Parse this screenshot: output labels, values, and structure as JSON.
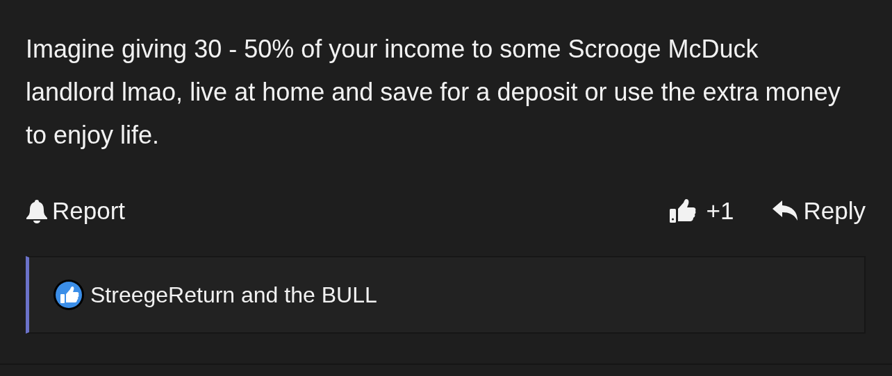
{
  "comment": {
    "text": "Imagine giving 30 - 50% of your income to some Scrooge McDuck landlord lmao, live at home and save for a deposit or use the extra money to enjoy life."
  },
  "actions": {
    "report": "Report",
    "like_count": "+1",
    "reply": "Reply"
  },
  "reactions": {
    "text": "StreegeReturn and the BULL"
  }
}
